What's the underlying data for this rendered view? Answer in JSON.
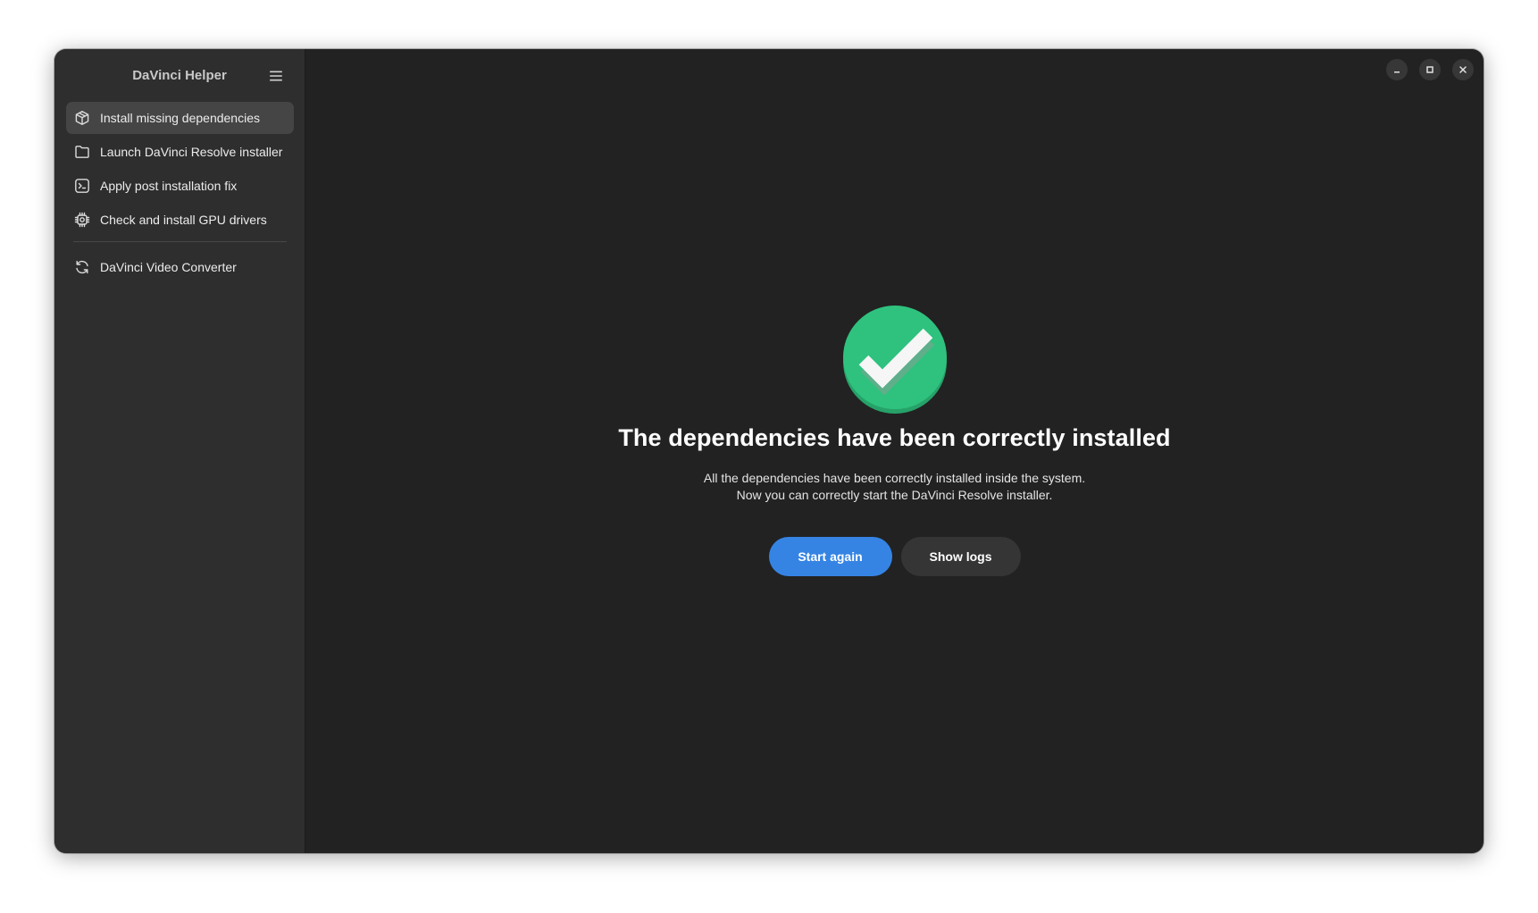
{
  "app": {
    "title": "DaVinci Helper"
  },
  "sidebar": {
    "items": [
      {
        "label": "Install missing dependencies",
        "icon": "package-icon",
        "selected": true
      },
      {
        "label": "Launch DaVinci Resolve installer",
        "icon": "folder-icon",
        "selected": false
      },
      {
        "label": "Apply post installation fix",
        "icon": "terminal-icon",
        "selected": false
      },
      {
        "label": "Check and install GPU drivers",
        "icon": "chip-icon",
        "selected": false
      }
    ],
    "secondary_items": [
      {
        "label": "DaVinci Video Converter",
        "icon": "refresh-icon",
        "selected": false
      }
    ]
  },
  "status": {
    "icon": "checkmark-icon",
    "title": "The dependencies have been correctly installed",
    "description_line1": "All the dependencies have been correctly installed inside the system.",
    "description_line2": "Now you can correctly start the DaVinci Resolve installer."
  },
  "actions": {
    "primary_label": "Start again",
    "secondary_label": "Show logs"
  },
  "colors": {
    "accent": "#3584e4",
    "success": "#2ec27e",
    "sidebar_bg": "#2e2e2e",
    "content_bg": "#222222"
  }
}
